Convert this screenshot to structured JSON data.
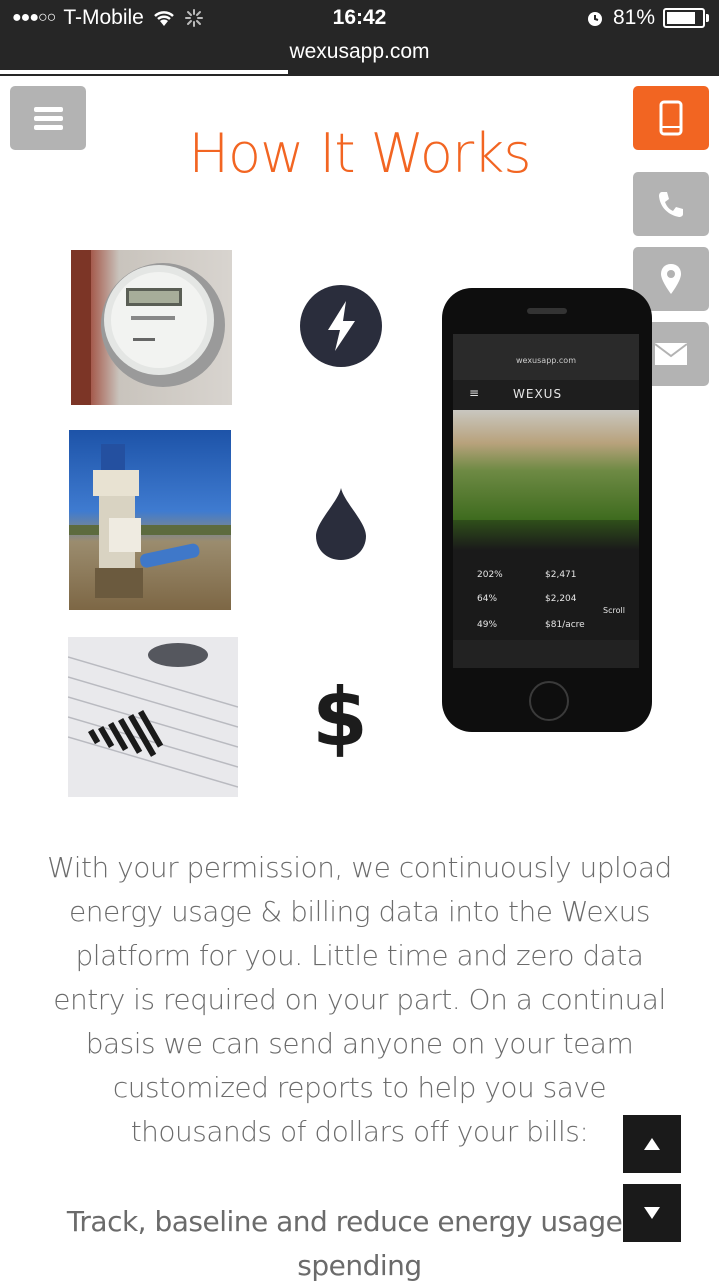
{
  "status_bar": {
    "carrier": "T-Mobile",
    "time": "16:42",
    "battery": "81%",
    "battery_level": 0.81,
    "url": "wexusapp.com",
    "page_load_progress": 0.4
  },
  "page": {
    "title": "How It Works",
    "paragraph": "With your permission, we continuously upload energy usage & billing data into the Wexus platform for you. Little time and zero data entry is required on your part. On a continual basis we can send anyone on your team customized reports to help you save thousands of dollars off your bills:",
    "list_item": "Track, baseline and reduce energy usage & spending"
  },
  "icons": {
    "lightning": "lightning-icon",
    "water": "water-drop-icon",
    "dollar": "$"
  },
  "phone_screen": {
    "url": "wexusapp.com",
    "brand": "WEXUS",
    "rows": [
      {
        "change": "202%",
        "amount": "$2,471"
      },
      {
        "change": "64%",
        "amount": "$2,204"
      },
      {
        "change": "49%",
        "amount": "$81/acre"
      }
    ],
    "scroll_label": "Scroll"
  },
  "colors": {
    "accent": "#f26522",
    "button_gray": "#b3b3b3",
    "text_gray": "#6b6b6b",
    "status_bar": "#262626"
  }
}
